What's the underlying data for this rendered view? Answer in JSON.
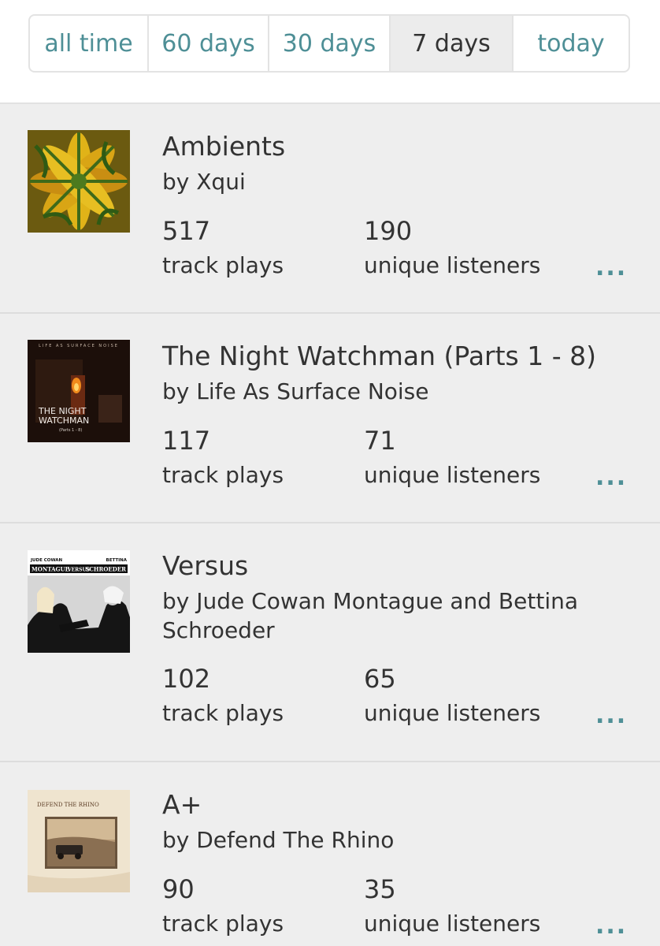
{
  "tabs": [
    {
      "label": "all time"
    },
    {
      "label": "60 days"
    },
    {
      "label": "30 days"
    },
    {
      "label": "7 days",
      "active": true
    },
    {
      "label": "today"
    }
  ],
  "colors": {
    "accent": "#4e8f96",
    "text": "#333333",
    "list_bg": "#eeeeee"
  },
  "entries": [
    {
      "title": "Ambients",
      "artist": "by Xqui",
      "track_plays": "517",
      "track_plays_label": "track plays",
      "unique_listeners": "190",
      "unique_listeners_label": "unique listeners",
      "more": "..."
    },
    {
      "title": "The Night Watchman (Parts 1 - 8)",
      "artist": "by Life As Surface Noise",
      "track_plays": "117",
      "track_plays_label": "track plays",
      "unique_listeners": "71",
      "unique_listeners_label": "unique listeners",
      "more": "...",
      "cover_text": [
        "LIFE AS SURFACE NOISE",
        "THE NIGHT",
        "WATCHMAN",
        "(Parts 1 - 8)"
      ]
    },
    {
      "title": "Versus",
      "artist": "by Jude Cowan Montague and Bettina Schroeder",
      "track_plays": "102",
      "track_plays_label": "track plays",
      "unique_listeners": "65",
      "unique_listeners_label": "unique listeners",
      "more": "...",
      "cover_text": [
        "JUDE COWAN",
        "BETTINA",
        "MONTAGUE",
        "VERSUS",
        "SCHROEDER"
      ]
    },
    {
      "title": "A+",
      "artist": "by Defend The Rhino",
      "track_plays": "90",
      "track_plays_label": "track plays",
      "unique_listeners": "35",
      "unique_listeners_label": "unique listeners",
      "more": "...",
      "cover_text": [
        "DEFEND THE RHINO"
      ]
    }
  ]
}
